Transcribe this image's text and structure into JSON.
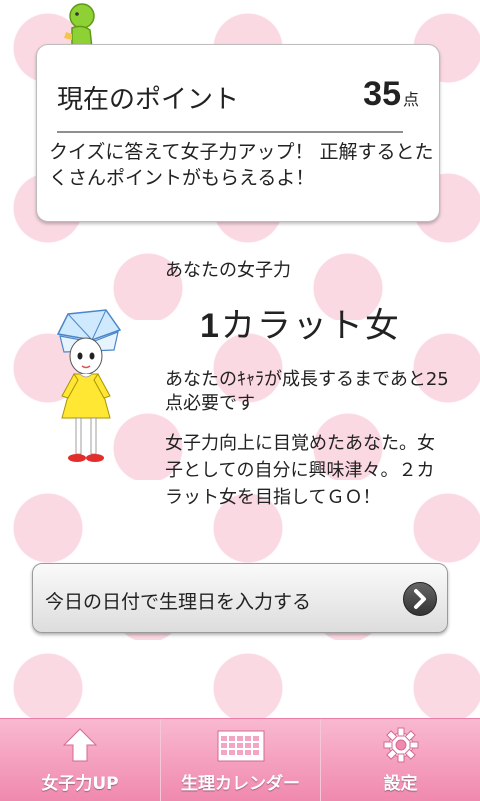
{
  "points_card": {
    "label": "現在のポイント",
    "value": "35",
    "unit": "点",
    "message": "クイズに答えて女子力アップ！ 正解するとたくさんポイントがもらえるよ！"
  },
  "profile": {
    "section_title": "あなたの女子力",
    "rank_number": "1",
    "rank_text": "カラット女",
    "remaining": "あなたのｷｬﾗが成長するまであと25点必要です",
    "description": "女子力向上に目覚めたあなた。女子としての自分に興味津々。２カラット女を目指してＧＯ！"
  },
  "action": {
    "label": "今日の日付で生理日を入力する"
  },
  "tabs": [
    {
      "label": "女子力UP",
      "icon": "up-arrow-icon"
    },
    {
      "label": "生理カレンダー",
      "icon": "calendar-icon"
    },
    {
      "label": "設定",
      "icon": "gear-icon"
    }
  ],
  "colors": {
    "polka_dot": "#fbd9e3",
    "tabbar": "#f089ae",
    "accent_green": "#8dd135"
  }
}
